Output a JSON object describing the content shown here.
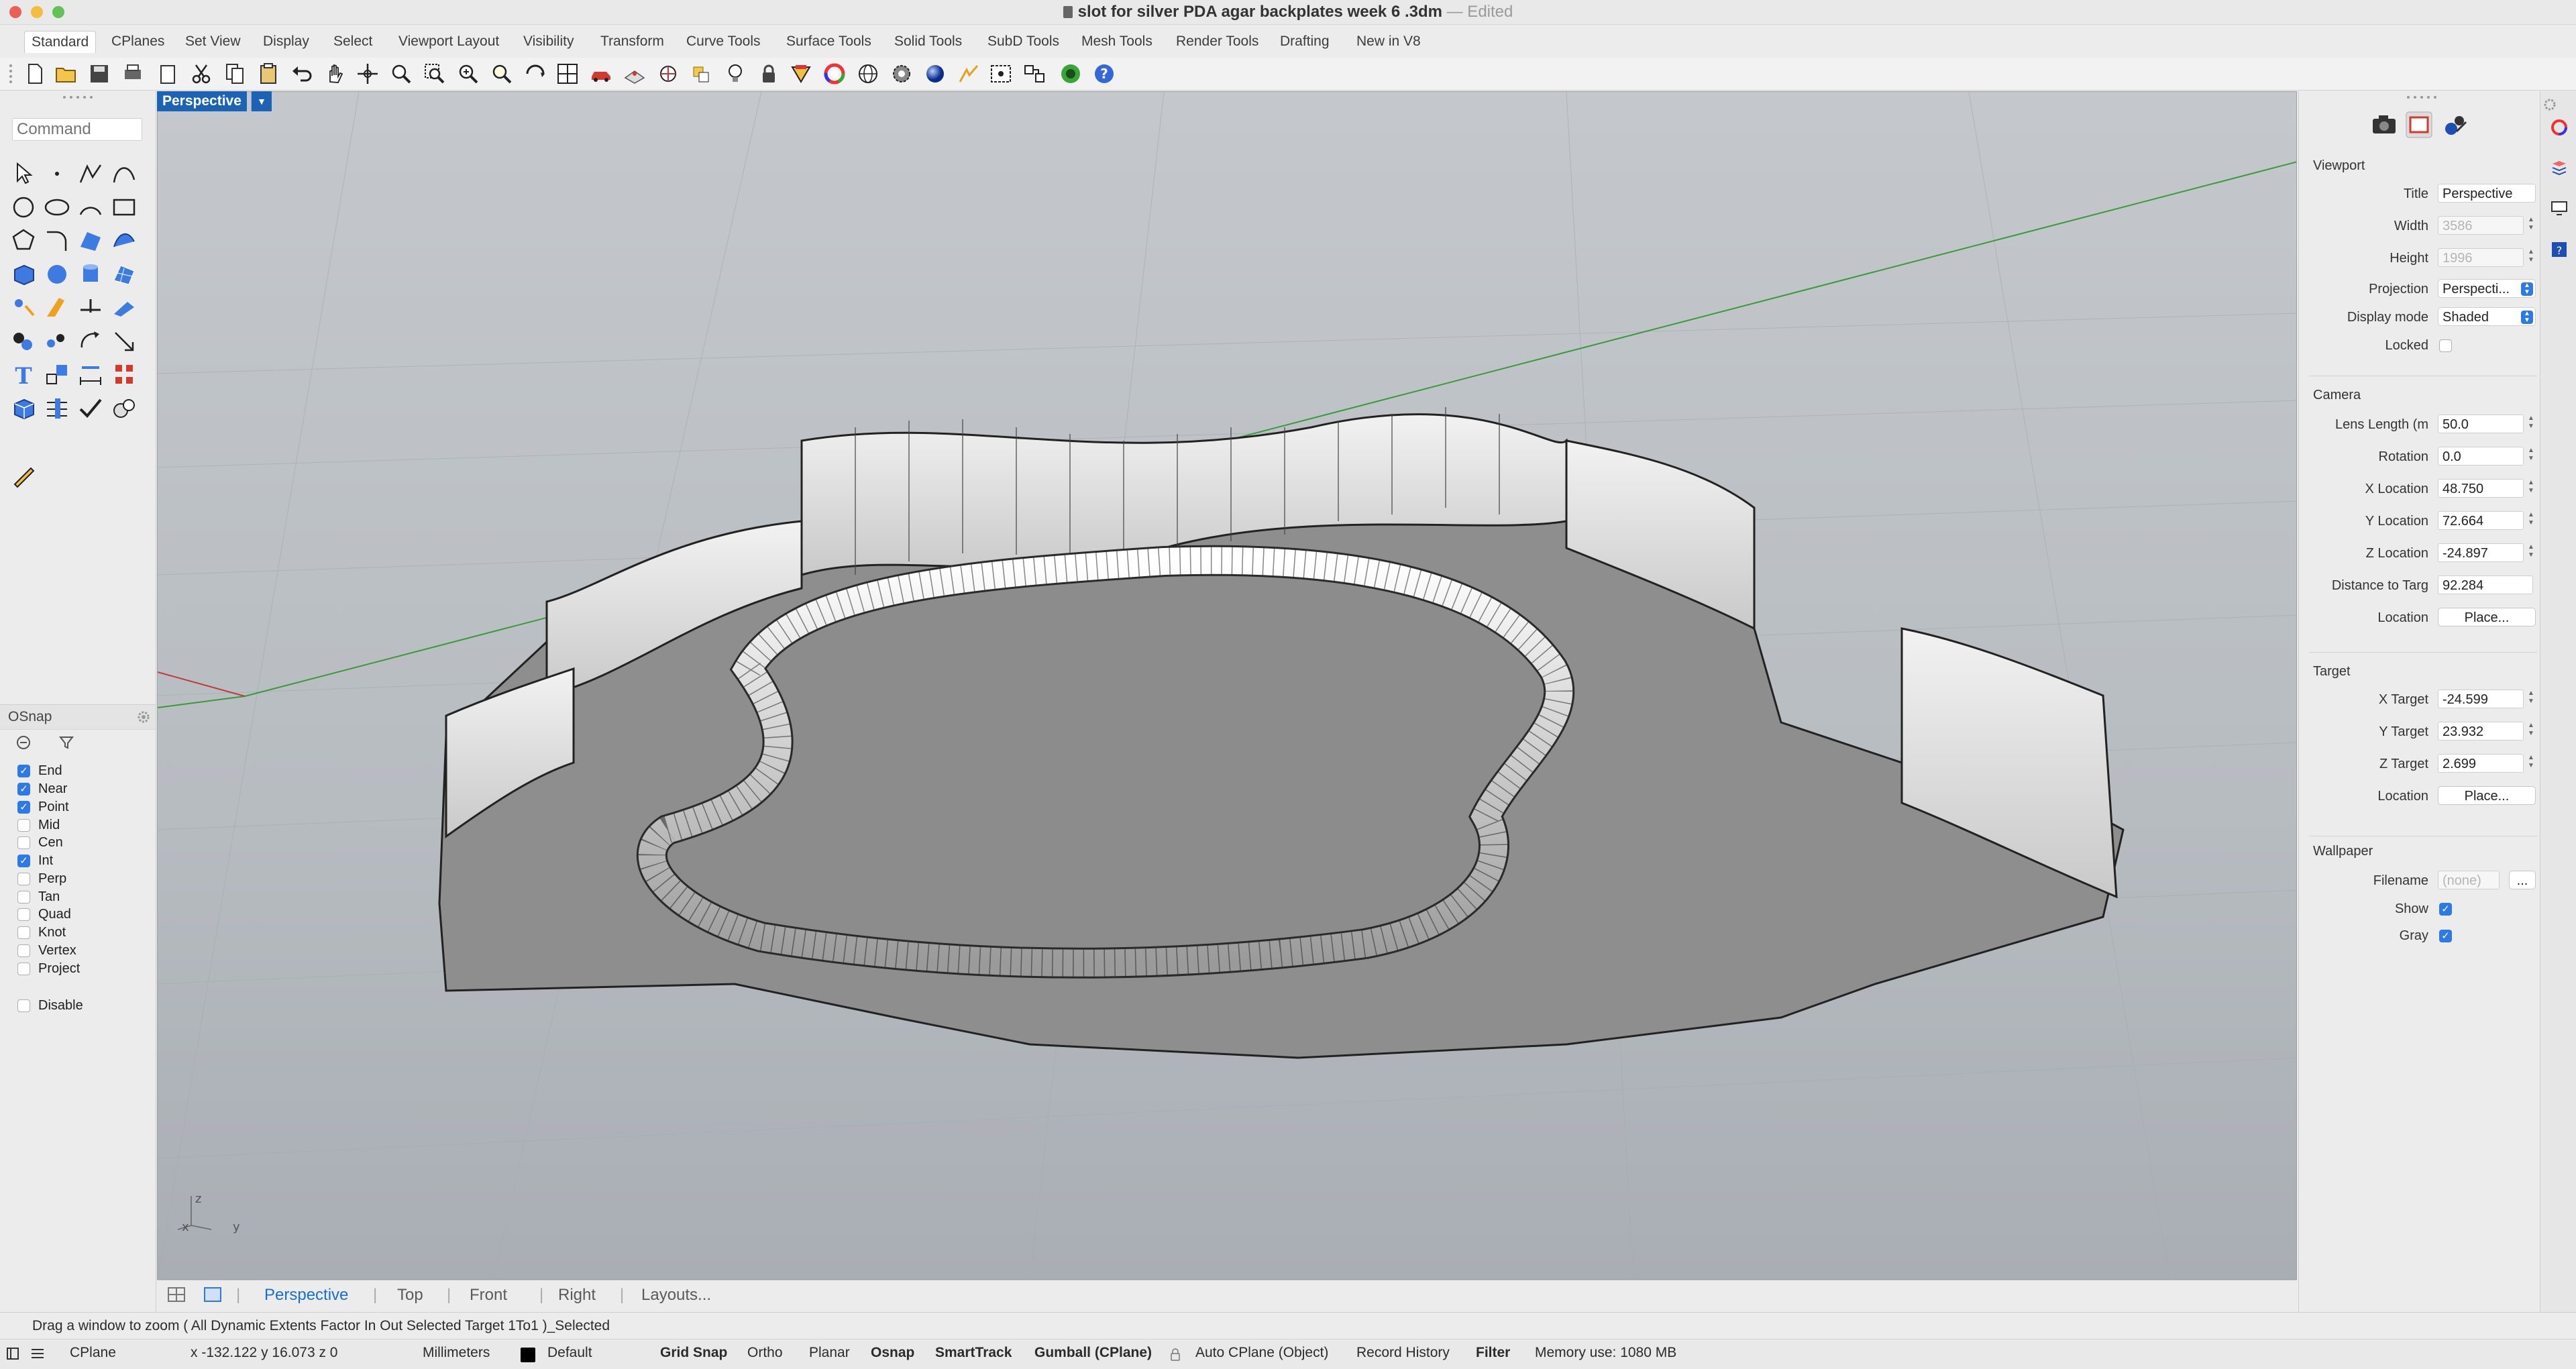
{
  "window": {
    "title": "slot for silver PDA agar backplates week 6 .3dm",
    "edited": "— Edited"
  },
  "tabs": [
    "Standard",
    "CPlanes",
    "Set View",
    "Display",
    "Select",
    "Viewport Layout",
    "Visibility",
    "Transform",
    "Curve Tools",
    "Surface Tools",
    "Solid Tools",
    "SubD Tools",
    "Mesh Tools",
    "Render Tools",
    "Drafting",
    "New in V8"
  ],
  "command": {
    "placeholder": "Command"
  },
  "osnap": {
    "title": "OSnap",
    "items": [
      {
        "label": "End",
        "checked": true
      },
      {
        "label": "Near",
        "checked": true
      },
      {
        "label": "Point",
        "checked": true
      },
      {
        "label": "Mid",
        "checked": false
      },
      {
        "label": "Cen",
        "checked": false
      },
      {
        "label": "Int",
        "checked": true
      },
      {
        "label": "Perp",
        "checked": false
      },
      {
        "label": "Tan",
        "checked": false
      },
      {
        "label": "Quad",
        "checked": false
      },
      {
        "label": "Knot",
        "checked": false
      },
      {
        "label": "Vertex",
        "checked": false
      },
      {
        "label": "Project",
        "checked": false
      }
    ],
    "disable": "Disable"
  },
  "viewport": {
    "name": "Perspective",
    "axes": {
      "z": "z",
      "x": "x",
      "y": "y"
    },
    "tabs": [
      "Perspective",
      "Top",
      "Front",
      "Right",
      "Layouts..."
    ]
  },
  "properties": {
    "viewport_section": "Viewport",
    "title_label": "Title",
    "title_value": "Perspective",
    "width_label": "Width",
    "width_value": "3586",
    "height_label": "Height",
    "height_value": "1996",
    "projection_label": "Projection",
    "projection_value": "Perspecti...",
    "display_label": "Display mode",
    "display_value": "Shaded",
    "locked_label": "Locked",
    "camera_section": "Camera",
    "lens_label": "Lens Length (m",
    "lens_value": "50.0",
    "rotation_label": "Rotation",
    "rotation_value": "0.0",
    "xloc_label": "X Location",
    "xloc_value": "48.750",
    "yloc_label": "Y Location",
    "yloc_value": "72.664",
    "zloc_label": "Z Location",
    "zloc_value": "-24.897",
    "dist_label": "Distance to Targ",
    "dist_value": "92.284",
    "location_label": "Location",
    "place_label": "Place...",
    "target_section": "Target",
    "xt_label": "X Target",
    "xt_value": "-24.599",
    "yt_label": "Y Target",
    "yt_value": "23.932",
    "zt_label": "Z Target",
    "zt_value": "2.699",
    "wallpaper_section": "Wallpaper",
    "filename_label": "Filename",
    "filename_value": "(none)",
    "browse_label": "...",
    "show_label": "Show",
    "gray_label": "Gray"
  },
  "status": {
    "message": "Drag a window to zoom ( All Dynamic Extents Factor In Out Selected Target 1To1 )_Selected",
    "cplane": "CPlane",
    "coords": "x -132.122  y 16.073  z 0",
    "units": "Millimeters",
    "layer": "Default",
    "grid_snap": "Grid Snap",
    "ortho": "Ortho",
    "planar": "Planar",
    "osnap": "Osnap",
    "smarttrack": "SmartTrack",
    "gumball": "Gumball (CPlane)",
    "auto_cplane": "Auto CPlane (Object)",
    "record_history": "Record History",
    "filter": "Filter",
    "memory": "Memory use: 1080 MB"
  }
}
